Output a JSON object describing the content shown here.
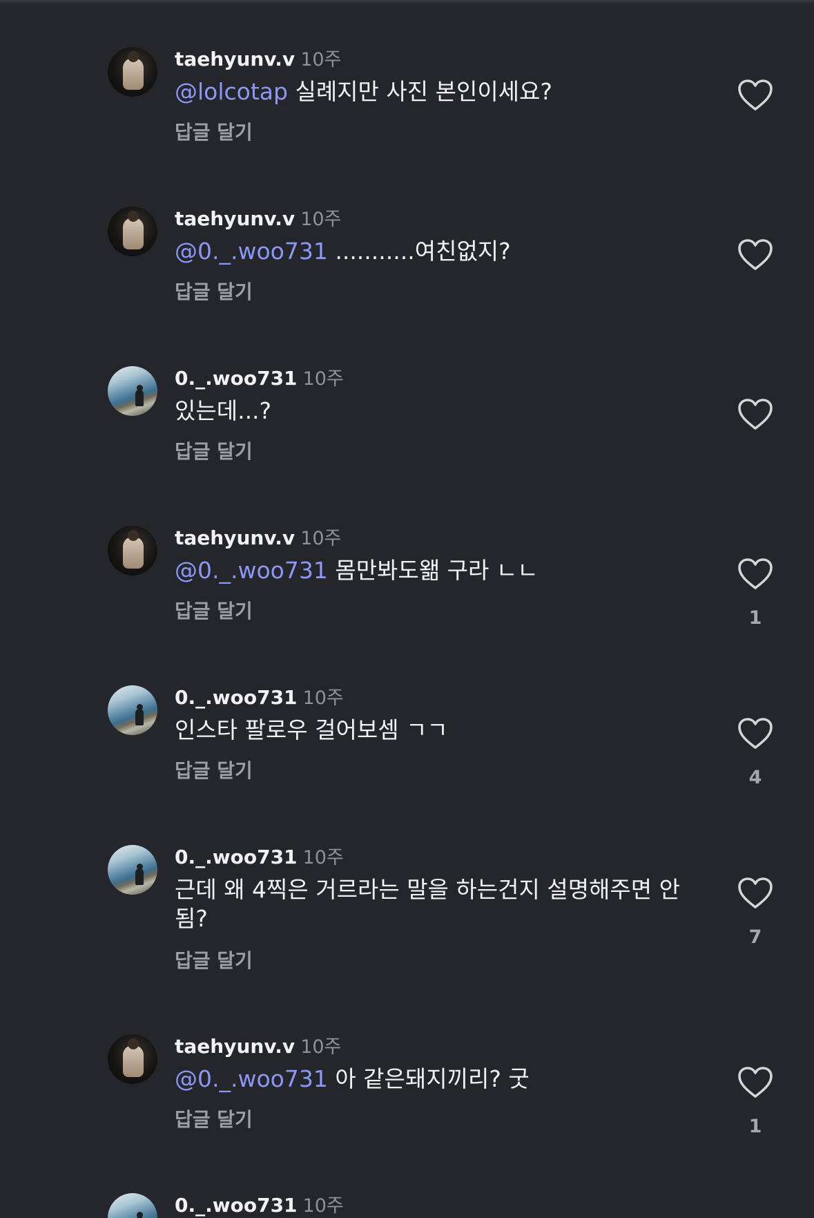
{
  "comments": [
    {
      "username": "taehyunv.v",
      "time": "10주",
      "mention": "@lolcotap",
      "text": " 실례지만 사진 본인이세요?",
      "reply_label": "답글 달기",
      "likes": ""
    },
    {
      "username": "taehyunv.v",
      "time": "10주",
      "mention": "@0._.woo731",
      "text": " ...........여친없지?",
      "reply_label": "답글 달기",
      "likes": ""
    },
    {
      "username": "0._.woo731",
      "time": "10주",
      "mention": "",
      "text": "있는데...?",
      "reply_label": "답글 달기",
      "likes": ""
    },
    {
      "username": "taehyunv.v",
      "time": "10주",
      "mention": "@0._.woo731",
      "text": " 몸만봐도왦 구라 ㄴㄴ",
      "reply_label": "답글 달기",
      "likes": "1"
    },
    {
      "username": "0._.woo731",
      "time": "10주",
      "mention": "",
      "text": "인스타 팔로우 걸어보셈 ㄱㄱ",
      "reply_label": "답글 달기",
      "likes": "4"
    },
    {
      "username": "0._.woo731",
      "time": "10주",
      "mention": "",
      "text": "근데 왜 4찍은 거르라는 말을 하는건지 설명해주면 안됨?",
      "reply_label": "답글 달기",
      "likes": "7"
    },
    {
      "username": "taehyunv.v",
      "time": "10주",
      "mention": "@0._.woo731",
      "text": " 아 같은돼지끼리? 굿",
      "reply_label": "답글 달기",
      "likes": "1"
    },
    {
      "username": "0._.woo731",
      "time": "10주",
      "mention": "",
      "text": "",
      "reply_label": "",
      "likes": ""
    }
  ],
  "icons": {
    "like": "heart-outline-icon"
  },
  "colors": {
    "background": "#24262c",
    "mention": "#8c98f5",
    "secondary_text": "#8e9199"
  }
}
